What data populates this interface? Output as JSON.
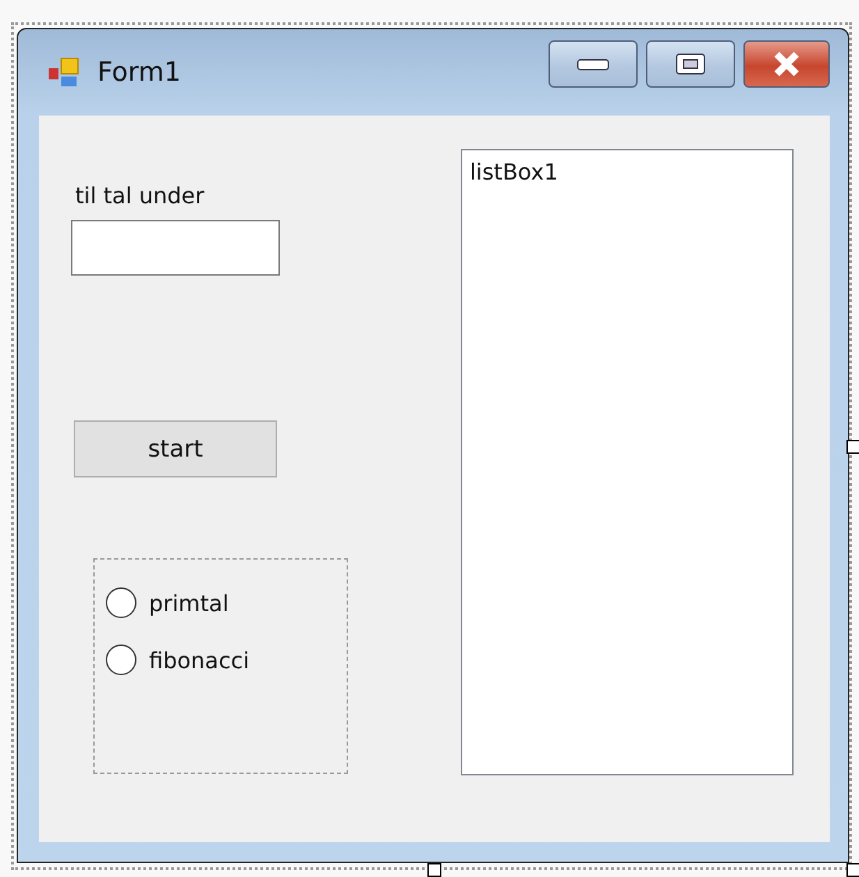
{
  "window": {
    "title": "Form1"
  },
  "label": "til tal under",
  "button": "start",
  "radios": [
    {
      "label": "primtal",
      "selected": false
    },
    {
      "label": "fibonacci",
      "selected": false
    }
  ],
  "listbox": {
    "items": [
      "listBox1"
    ]
  }
}
